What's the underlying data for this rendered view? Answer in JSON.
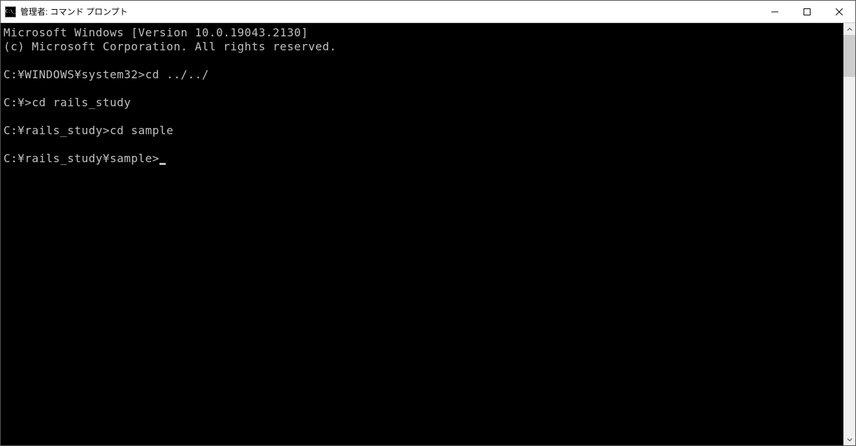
{
  "window": {
    "title": "管理者: コマンド プロンプト"
  },
  "terminal": {
    "lines": [
      "Microsoft Windows [Version 10.0.19043.2130]",
      "(c) Microsoft Corporation. All rights reserved.",
      "",
      "C:\\WINDOWS\\system32>cd ../../",
      "",
      "C:\\>cd rails_study",
      "",
      "C:\\rails_study>cd sample",
      "",
      "C:\\rails_study\\sample>"
    ],
    "cursor_on_last": true
  }
}
